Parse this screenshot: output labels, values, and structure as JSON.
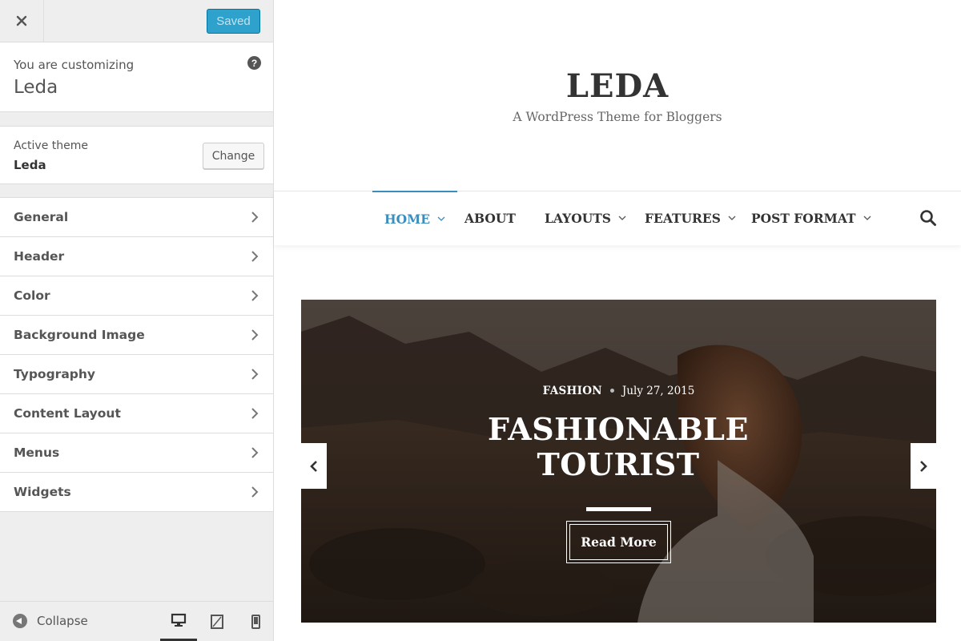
{
  "topbar": {
    "close_icon": "close-icon",
    "saved_label": "Saved"
  },
  "info": {
    "customizing_label": "You are customizing",
    "site_name": "Leda",
    "help_icon": "?"
  },
  "theme": {
    "active_label": "Active theme",
    "active_name": "Leda",
    "change_label": "Change"
  },
  "sections": [
    {
      "label": "General"
    },
    {
      "label": "Header"
    },
    {
      "label": "Color"
    },
    {
      "label": "Background Image"
    },
    {
      "label": "Typography"
    },
    {
      "label": "Content Layout"
    },
    {
      "label": "Menus"
    },
    {
      "label": "Widgets"
    }
  ],
  "footer": {
    "collapse_label": "Collapse",
    "devices": [
      "desktop-icon",
      "tablet-icon",
      "mobile-icon"
    ],
    "active_device": "desktop"
  },
  "site": {
    "title": "LEDA",
    "tagline": "A WordPress Theme for Bloggers"
  },
  "nav": {
    "items": [
      {
        "label": "HOME",
        "has_dropdown": true,
        "active": true
      },
      {
        "label": "ABOUT",
        "has_dropdown": false
      },
      {
        "label": "LAYOUTS",
        "has_dropdown": true
      },
      {
        "label": "FEATURES",
        "has_dropdown": true
      },
      {
        "label": "POST FORMAT",
        "has_dropdown": true
      }
    ],
    "active_color": "#3b8dbd"
  },
  "slide": {
    "category": "FASHION",
    "date": "July 27, 2015",
    "title_line1": "FASHIONABLE",
    "title_line2": "TOURIST",
    "button_label": "Read More"
  },
  "colors": {
    "accent": "#2ea2cc",
    "nav_active": "#3b8dbd"
  }
}
